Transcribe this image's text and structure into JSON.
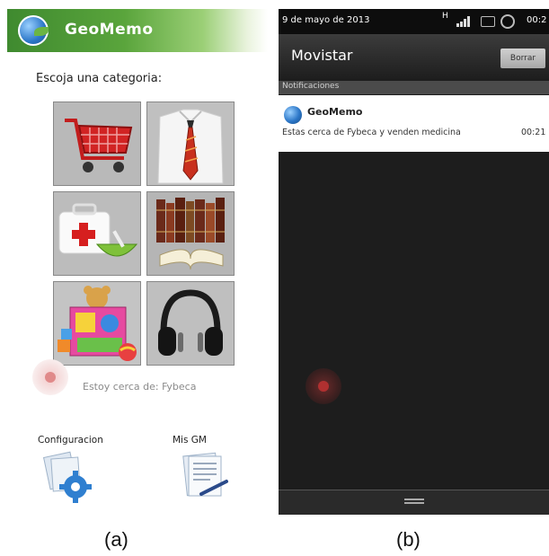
{
  "screen_a": {
    "app_title": "GeoMemo",
    "prompt": "Escoja una categoria:",
    "categories": [
      {
        "icon": "shopping-cart-icon"
      },
      {
        "icon": "shirt-tie-icon"
      },
      {
        "icon": "medical-kit-icon"
      },
      {
        "icon": "books-icon"
      },
      {
        "icon": "toys-icon"
      },
      {
        "icon": "headphones-icon"
      }
    ],
    "status_text": "Estoy cerca de: Fybeca",
    "bottom": {
      "config_label": "Configuracion",
      "misgm_label": "Mis GM"
    }
  },
  "screen_b": {
    "date": "9 de mayo de 2013",
    "time": "00:2",
    "carrier": "Movistar",
    "clear_button": "Borrar",
    "section_label": "Notificaciones",
    "notification": {
      "title": "GeoMemo",
      "text": "Estas cerca de Fybeca y venden medicina",
      "time": "00:21"
    }
  },
  "captions": {
    "a": "(a)",
    "b": "(b)"
  },
  "colors": {
    "header_green": "#3f8a2f",
    "dark_bg": "#1d1d1d"
  }
}
